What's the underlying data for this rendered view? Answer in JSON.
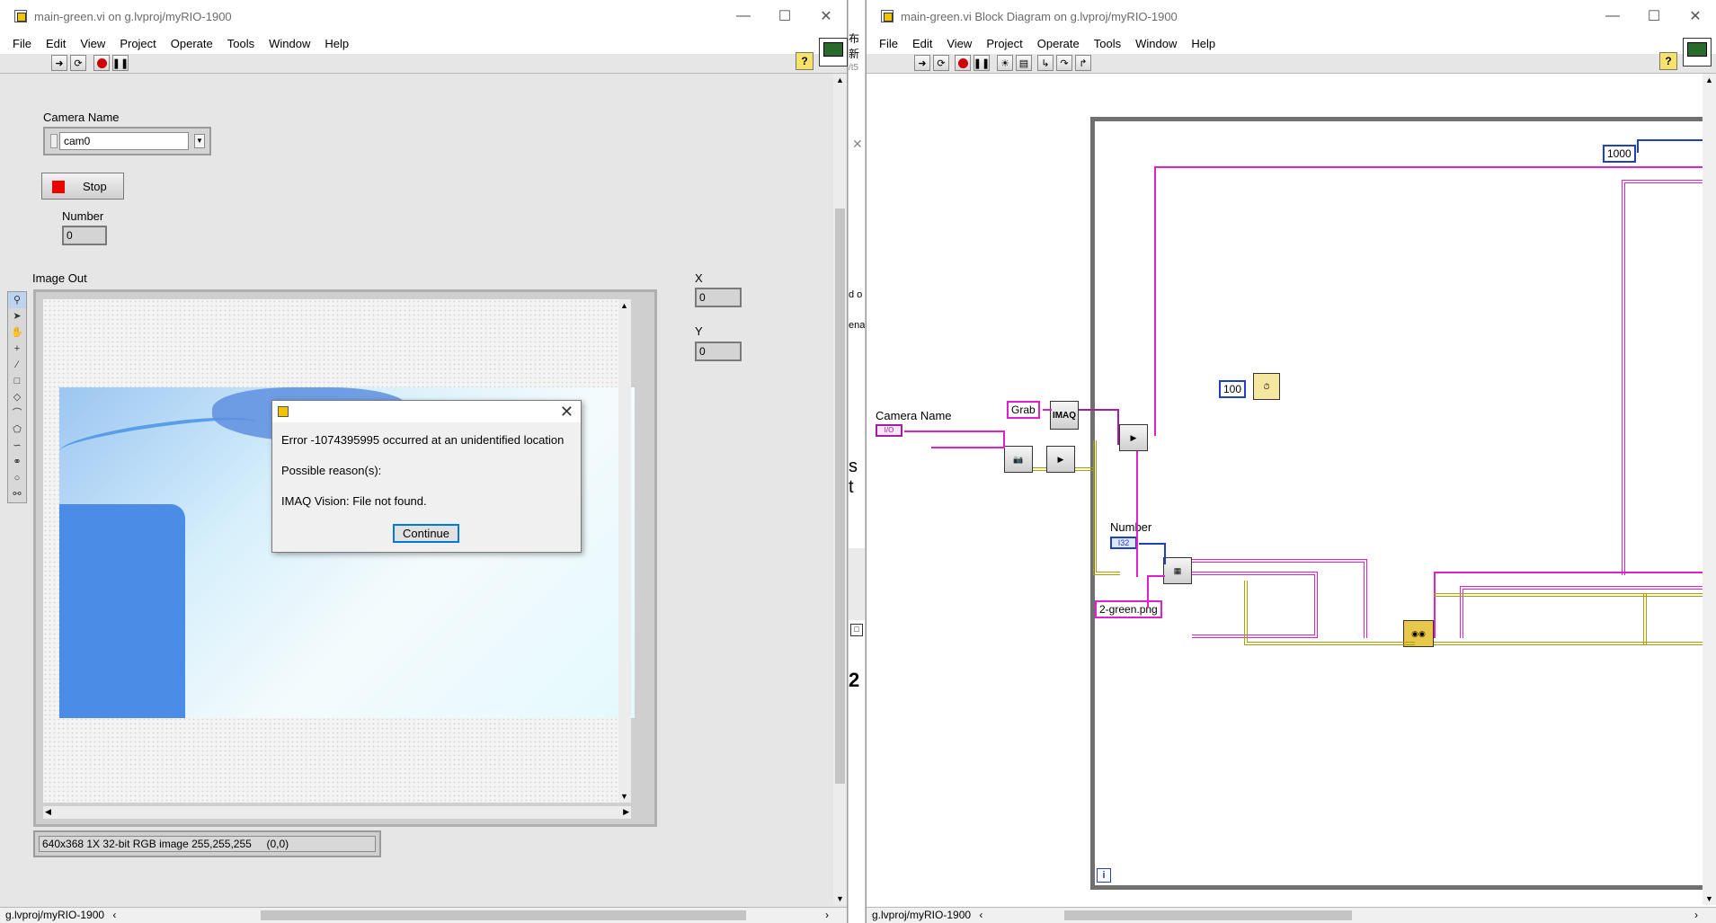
{
  "front_panel": {
    "title": "main-green.vi on g.lvproj/myRIO-1900",
    "menu": [
      "File",
      "Edit",
      "View",
      "Project",
      "Operate",
      "Tools",
      "Window",
      "Help"
    ],
    "camera_name_label": "Camera Name",
    "camera_name_value": "cam0",
    "stop_label": "Stop",
    "number_label": "Number",
    "number_value": "0",
    "image_out_label": "Image Out",
    "x_label": "X",
    "x_value": "0",
    "y_label": "Y",
    "y_value": "0",
    "image_info": "640x368 1X 32-bit RGB image 255,255,255     (0,0)",
    "status": "g.lvproj/myRIO-1900"
  },
  "dialog": {
    "line1": "Error -1074395995 occurred at an unidentified location",
    "line2": "Possible reason(s):",
    "line3": "IMAQ Vision:  File not found.",
    "button": "Continue"
  },
  "block_diagram": {
    "title": "main-green.vi Block Diagram on g.lvproj/myRIO-1900",
    "menu": [
      "File",
      "Edit",
      "View",
      "Project",
      "Operate",
      "Tools",
      "Window",
      "Help"
    ],
    "camera_name_label": "Camera Name",
    "camera_terminal": "I/O",
    "grab_const": "Grab",
    "imaq_label": "IMAQ",
    "number_label": "Number",
    "number_terminal": "I32",
    "const_1000": "1000",
    "const_100": "100",
    "file_const": "2-green.png",
    "loop_index": "i",
    "status": "g.lvproj/myRIO-1900"
  },
  "gap_fragments": [
    "布新",
    "/t5",
    "d o",
    "ena",
    "s t",
    "2"
  ],
  "colors": {
    "path_wire": "#e020c8",
    "int_wire": "#2040c0",
    "refnum_wire": "#a8a000",
    "stop_red": "#ee0000"
  }
}
